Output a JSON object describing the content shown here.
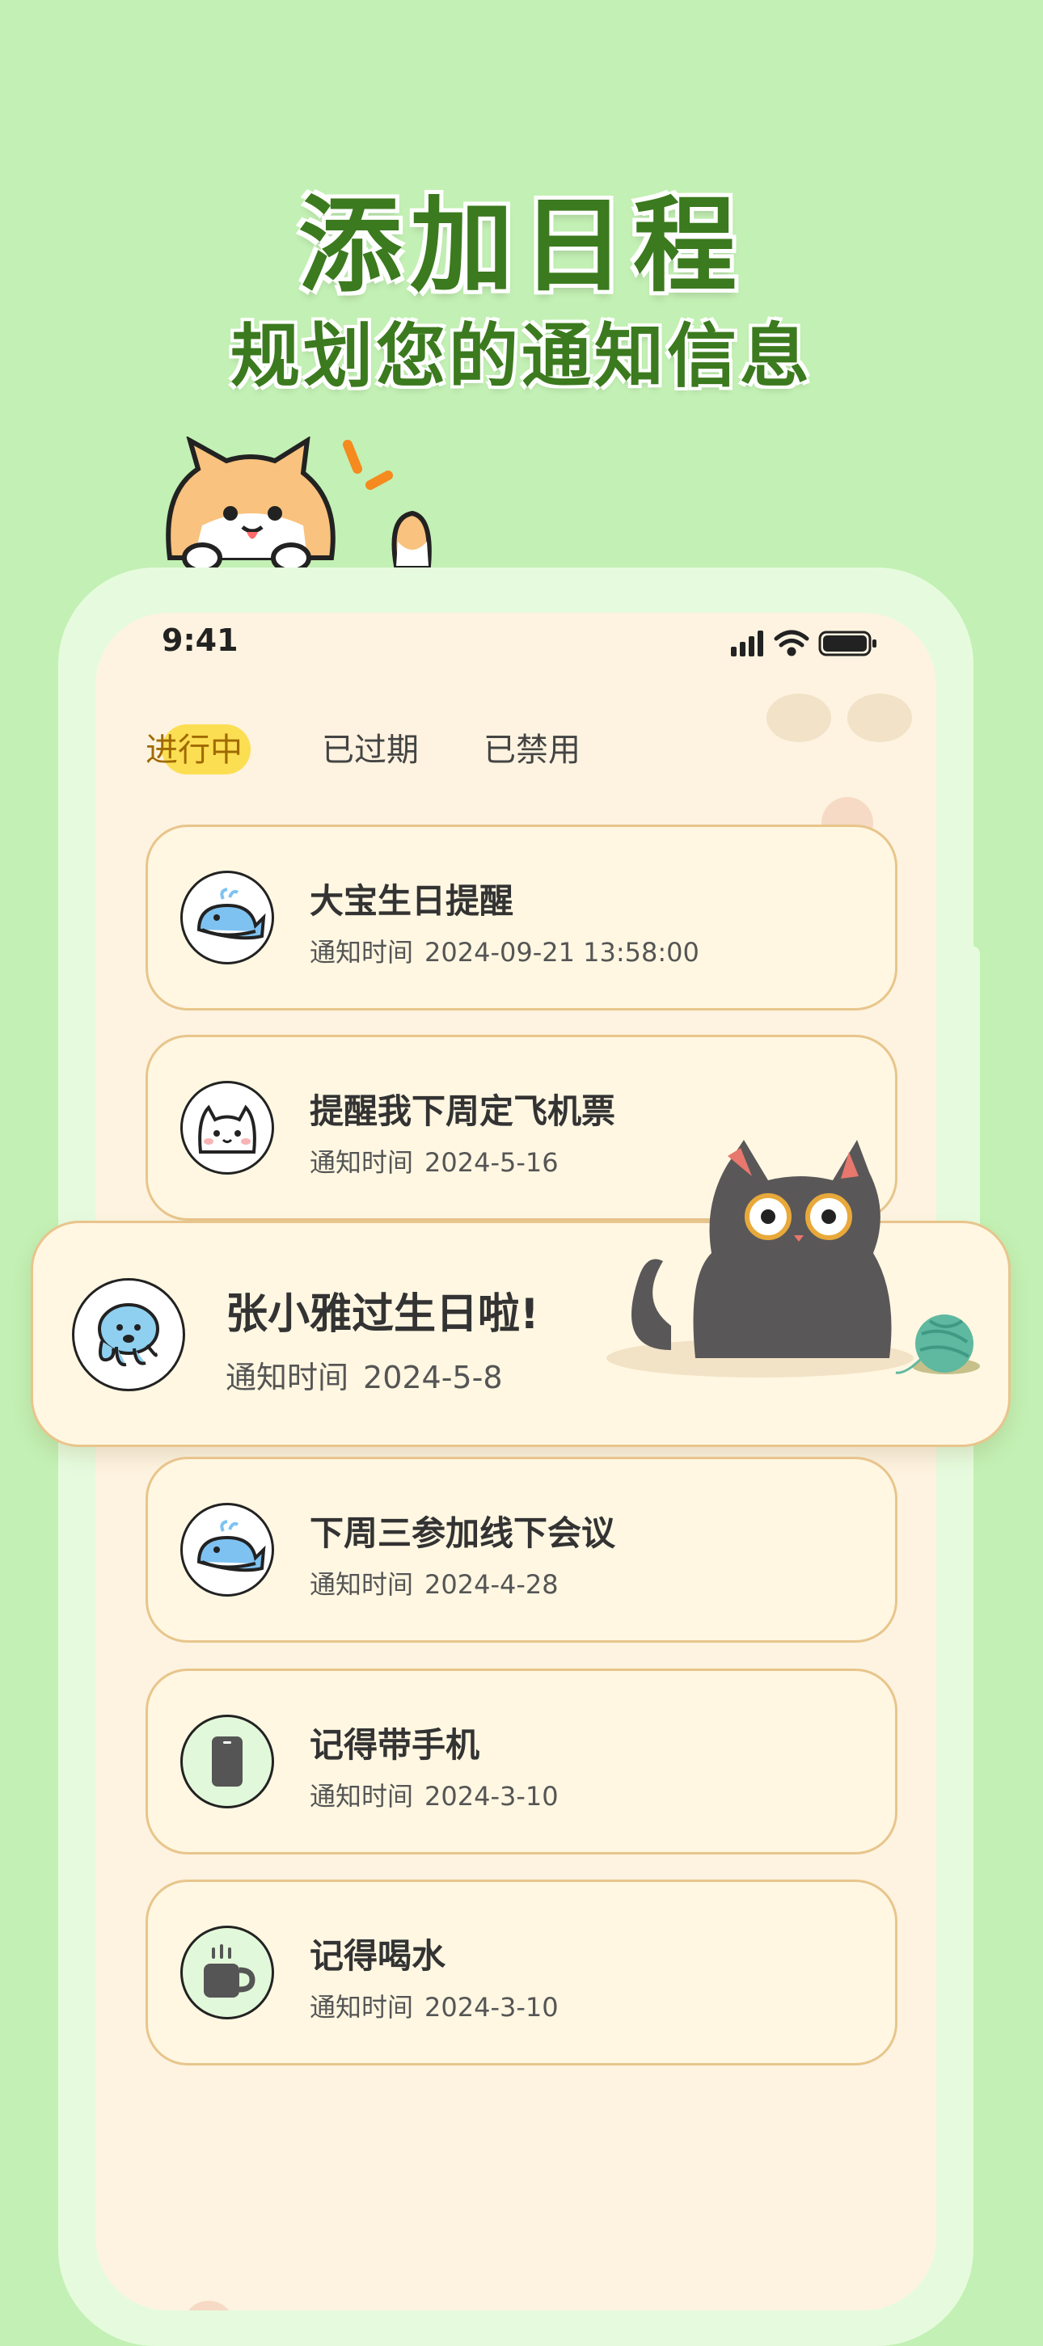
{
  "hero": {
    "title": "添加日程",
    "subtitle": "规划您的通知信息"
  },
  "status_bar": {
    "time": "9:41"
  },
  "tabs": [
    {
      "label": "进行中",
      "active": true
    },
    {
      "label": "已过期",
      "active": false
    },
    {
      "label": "已禁用",
      "active": false
    }
  ],
  "time_label": "通知时间",
  "cards": [
    {
      "title": "大宝生日提醒",
      "time": "2024-09-21 13:58:00",
      "icon": "whale-icon"
    },
    {
      "title": "提醒我下周定飞机票",
      "time": "2024-5-16",
      "icon": "cat-face-icon"
    },
    {
      "title": "下周三参加线下会议",
      "time": "2024-4-28",
      "icon": "whale-icon"
    },
    {
      "title": "记得带手机",
      "time": "2024-3-10",
      "icon": "phone-icon"
    },
    {
      "title": "记得喝水",
      "time": "2024-3-10",
      "icon": "cup-icon"
    }
  ],
  "featured_card": {
    "title": "张小雅过生日啦!",
    "time": "2024-5-8",
    "icon": "octopus-icon"
  },
  "colors": {
    "background": "#c3f0b4",
    "accent": "#3b7a1e",
    "card": "#fff7e2",
    "card_border": "#e8c58c",
    "tab_highlight": "#fcd93a"
  }
}
